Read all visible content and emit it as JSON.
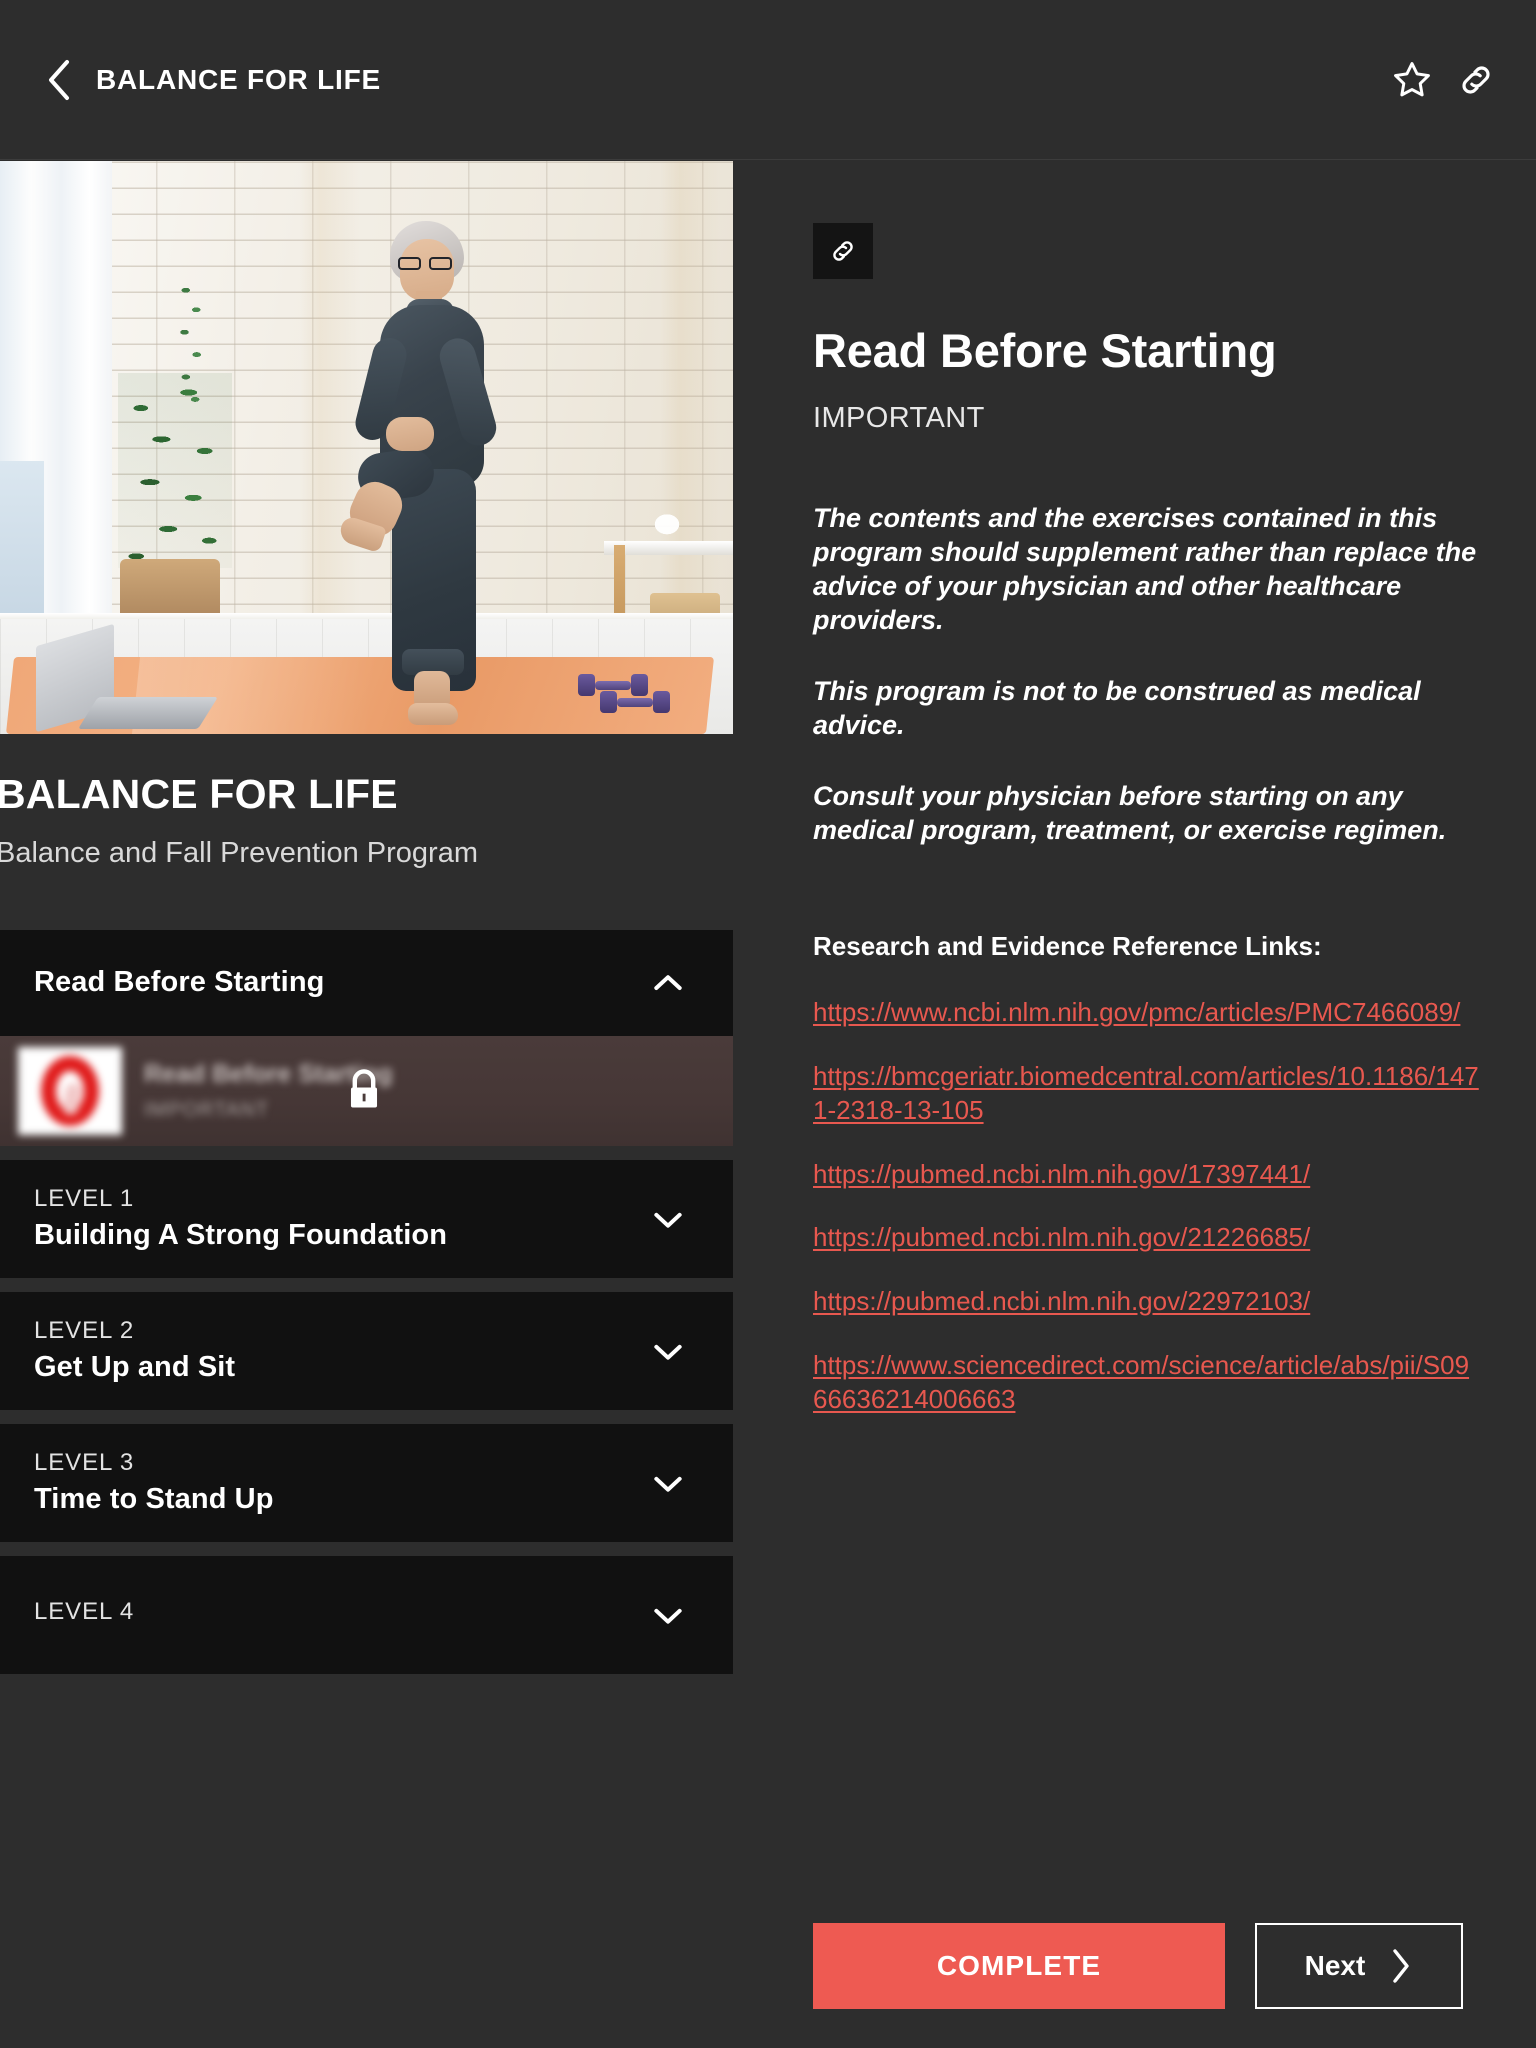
{
  "topbar": {
    "title": "BALANCE FOR LIFE",
    "back_icon": "chevron-left-icon",
    "favorite_icon": "star-outline-icon",
    "share_icon": "link-icon"
  },
  "sidebar": {
    "hero_alt": "Senior woman doing a standing balance exercise on an orange yoga mat",
    "course_title": "BALANCE FOR LIFE",
    "course_subtitle": "Balance and Fall Prevention Program",
    "sections": [
      {
        "eyebrow": "",
        "title": "Read Before Starting",
        "state": "expanded",
        "chevron": "chevron-up-icon",
        "lessons": [
          {
            "name": "Read Before Starting",
            "tag": "IMPORTANT",
            "locked": true,
            "lock_icon": "lock-icon",
            "thumb": "red-warning-circle-thumbnail"
          }
        ]
      },
      {
        "eyebrow": "LEVEL 1",
        "title": "Building A Strong Foundation",
        "state": "collapsed",
        "chevron": "chevron-down-icon",
        "lessons": []
      },
      {
        "eyebrow": "LEVEL 2",
        "title": "Get Up and Sit",
        "state": "collapsed",
        "chevron": "chevron-down-icon",
        "lessons": []
      },
      {
        "eyebrow": "LEVEL 3",
        "title": "Time to Stand Up",
        "state": "collapsed",
        "chevron": "chevron-down-icon",
        "lessons": []
      },
      {
        "eyebrow": "LEVEL 4",
        "title": "",
        "state": "collapsed",
        "chevron": "chevron-down-icon",
        "lessons": []
      }
    ]
  },
  "content": {
    "link_chip_icon": "link-icon",
    "title": "Read Before Starting",
    "kicker": "IMPORTANT",
    "paragraphs": [
      "The contents and the exercises contained in this program should supplement rather than replace the advice of your physician and other healthcare providers.",
      "This program is not to be construed as medical advice.",
      "Consult your physician before starting on any medical program, treatment, or exercise regimen."
    ],
    "references_heading": "Research and Evidence Reference Links:",
    "references": [
      "https://www.ncbi.nlm.nih.gov/pmc/articles/PMC7466089/",
      "https://bmcgeriatr.biomedcentral.com/articles/10.1186/1471-2318-13-105",
      "https://pubmed.ncbi.nlm.nih.gov/17397441/",
      "https://pubmed.ncbi.nlm.nih.gov/21226685/",
      "https://pubmed.ncbi.nlm.nih.gov/22972103/",
      "https://www.sciencedirect.com/science/article/abs/pii/S0966636214006663"
    ],
    "complete_label": "COMPLETE",
    "next_label": "Next",
    "next_icon": "chevron-right-icon"
  },
  "colors": {
    "page_background": "#2d2d2d",
    "panel_dark": "#111111",
    "accent_red": "#ee5a52",
    "link_red": "#e8584f",
    "locked_row": "#463736",
    "text_primary": "#ffffff",
    "text_secondary": "#d9d9d9"
  }
}
